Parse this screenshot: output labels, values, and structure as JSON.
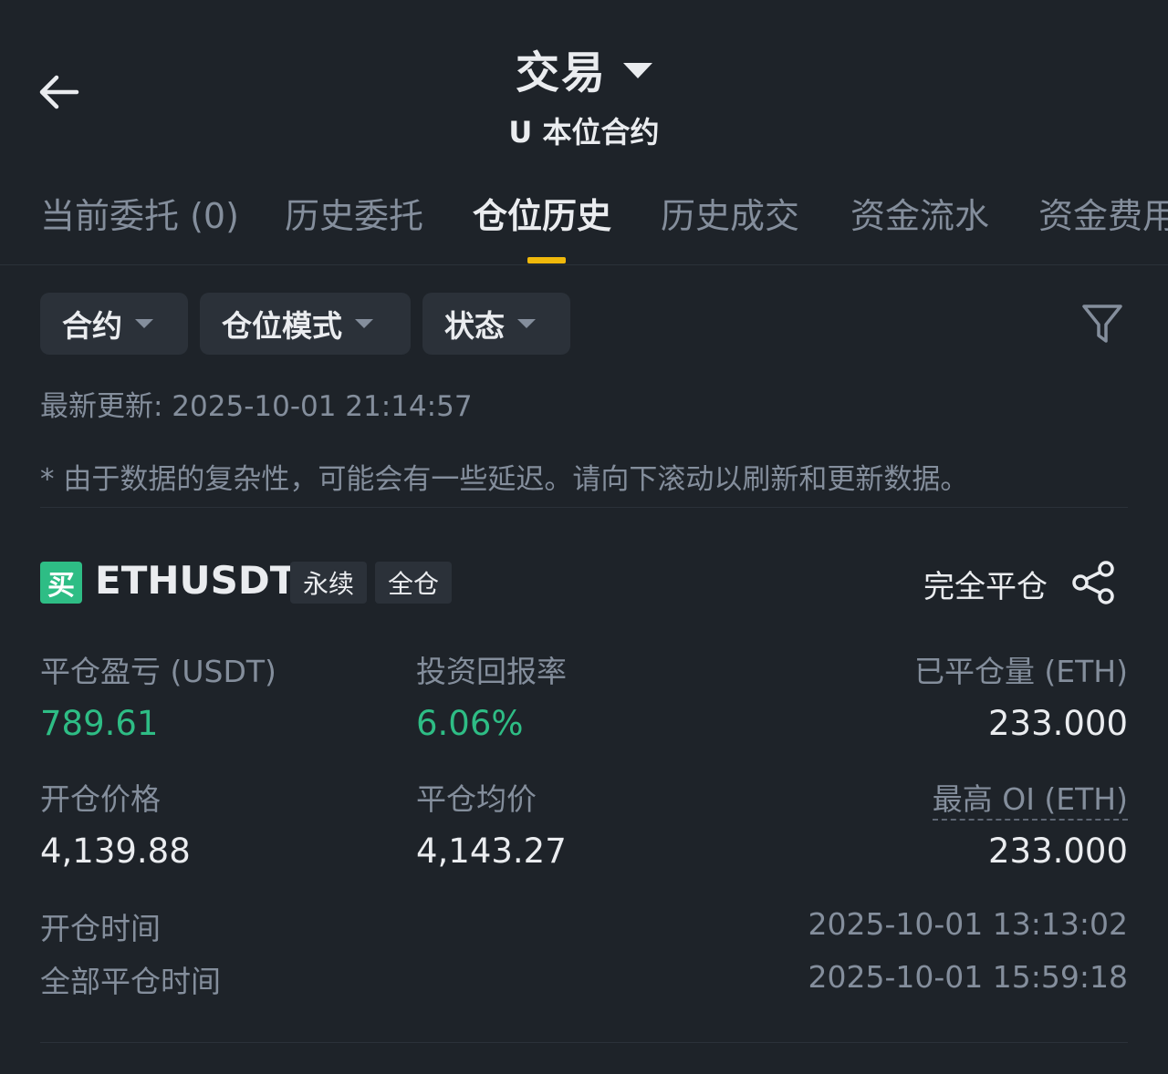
{
  "header": {
    "title": "交易",
    "subtitle": "U 本位合约"
  },
  "tabs": [
    {
      "label": "当前委托 (0)"
    },
    {
      "label": "历史委托"
    },
    {
      "label": "仓位历史"
    },
    {
      "label": "历史成交"
    },
    {
      "label": "资金流水"
    },
    {
      "label": "资金费用"
    }
  ],
  "active_tab": "仓位历史",
  "filters": {
    "contract": "合约",
    "position_mode": "仓位模式",
    "status": "状态"
  },
  "last_updated": "最新更新: 2025-10-01 21:14:57",
  "notice": "* 由于数据的复杂性，可能会有一些延迟。请向下滚动以刷新和更新数据。",
  "position": {
    "side_badge": "买",
    "symbol": "ETHUSDT",
    "tags": [
      "永续",
      "全仓"
    ],
    "close_all": "完全平仓",
    "fields": {
      "pnl_label": "平仓盈亏 (USDT)",
      "pnl_value": "789.61",
      "roi_label": "投资回报率",
      "roi_value": "6.06%",
      "closed_qty_label": "已平仓量 (ETH)",
      "closed_qty_value": "233.000",
      "entry_price_label": "开仓价格",
      "entry_price_value": "4,139.88",
      "avg_close_label": "平仓均价",
      "avg_close_value": "4,143.27",
      "max_oi_label": "最高 OI (ETH)",
      "max_oi_value": "233.000",
      "open_time_label": "开仓时间",
      "open_time_value": "2025-10-01 13:13:02",
      "close_time_label": "全部平仓时间",
      "close_time_value": "2025-10-01 15:59:18"
    }
  },
  "colors": {
    "background": "#1e2329",
    "accent": "#f0b90b",
    "positive": "#2ebd85",
    "muted": "#848e9c"
  }
}
